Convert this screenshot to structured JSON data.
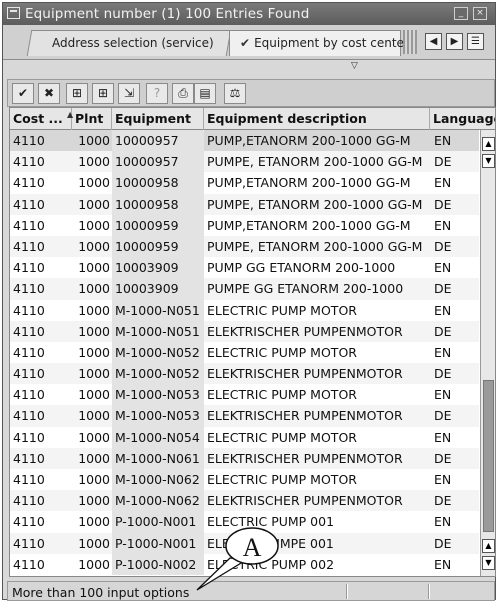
{
  "window": {
    "title": "Equipment number (1)  100 Entries Found",
    "minimize_glyph": "_",
    "close_glyph": "×"
  },
  "tabs": [
    {
      "label": "Address selection (service)"
    },
    {
      "label": "Equipment by cost center",
      "check": "✔"
    }
  ],
  "tab_nav": {
    "left": "◀",
    "right": "▶",
    "menu": "☰"
  },
  "toolbar": {
    "icons": [
      "checkmark-icon",
      "cancel-icon",
      "find-icon",
      "find-next-icon",
      "export-icon",
      "help-icon",
      "print-icon",
      "filter-icon",
      "settings-icon"
    ],
    "glyphs": [
      "✔",
      "✖",
      "⊞",
      "⊞",
      "⇲",
      "?",
      "⎙",
      "▤",
      "⚖"
    ]
  },
  "table": {
    "columns": [
      "Cost ...",
      "Plnt",
      "Equipment",
      "Equipment description",
      "Language"
    ],
    "rows": [
      [
        "4110",
        "1000",
        "10000957",
        "PUMP,ETANORM 200-1000 GG-M",
        "EN"
      ],
      [
        "4110",
        "1000",
        "10000957",
        "PUMPE, ETANORM 200-1000 GG-M",
        "DE"
      ],
      [
        "4110",
        "1000",
        "10000958",
        "PUMP,ETANORM 200-1000 GG-M",
        "EN"
      ],
      [
        "4110",
        "1000",
        "10000958",
        "PUMPE, ETANORM 200-1000 GG-M",
        "DE"
      ],
      [
        "4110",
        "1000",
        "10000959",
        "PUMP,ETANORM 200-1000 GG-M",
        "EN"
      ],
      [
        "4110",
        "1000",
        "10000959",
        "PUMPE, ETANORM 200-1000 GG-M",
        "DE"
      ],
      [
        "4110",
        "1000",
        "10003909",
        "PUMP GG  ETANORM 200-1000",
        "EN"
      ],
      [
        "4110",
        "1000",
        "10003909",
        "PUMPE GG ETANORM 200-1000",
        "DE"
      ],
      [
        "4110",
        "1000",
        "M-1000-N051",
        "ELECTRIC PUMP MOTOR",
        "EN"
      ],
      [
        "4110",
        "1000",
        "M-1000-N051",
        "ELEKTRISCHER PUMPENMOTOR",
        "DE"
      ],
      [
        "4110",
        "1000",
        "M-1000-N052",
        "ELECTRIC PUMP MOTOR",
        "EN"
      ],
      [
        "4110",
        "1000",
        "M-1000-N052",
        "ELEKTRISCHER PUMPENMOTOR",
        "DE"
      ],
      [
        "4110",
        "1000",
        "M-1000-N053",
        "ELECTRIC PUMP MOTOR",
        "EN"
      ],
      [
        "4110",
        "1000",
        "M-1000-N053",
        "ELEKTRISCHER PUMPENMOTOR",
        "DE"
      ],
      [
        "4110",
        "1000",
        "M-1000-N054",
        "ELECTRIC PUMP MOTOR",
        "EN"
      ],
      [
        "4110",
        "1000",
        "M-1000-N061",
        "ELEKTRISCHER PUMPENMOTOR",
        "DE"
      ],
      [
        "4110",
        "1000",
        "M-1000-N062",
        "ELECTRIC PUMP MOTOR",
        "EN"
      ],
      [
        "4110",
        "1000",
        "M-1000-N062",
        "ELEKTRISCHER PUMPENMOTOR",
        "DE"
      ],
      [
        "4110",
        "1000",
        "P-1000-N001",
        "ELECTRIC PUMP 001",
        "EN"
      ],
      [
        "4110",
        "1000",
        "P-1000-N001",
        "ELEKTROPUMPE 001",
        "DE"
      ],
      [
        "4110",
        "1000",
        "P-1000-N002",
        "ELECTRIC PUMP 002",
        "EN"
      ]
    ]
  },
  "scrollbar": {
    "up": "▲",
    "down": "▼"
  },
  "status": {
    "text": "More than  100 input options"
  },
  "callout": {
    "label": "A"
  }
}
